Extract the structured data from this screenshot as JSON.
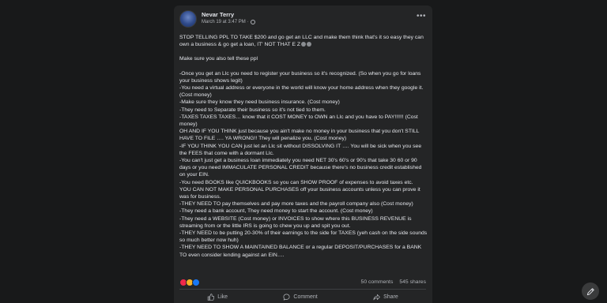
{
  "post": {
    "author": "Nevar Terry",
    "timestamp": "March 19 at 3:47 PM",
    "separator": "·",
    "lines": [
      "STOP TELLING PPL TO TAKE $200 and go get an LLC and make them think that's it so easy they can own a business & go get a loan, IT' NOT THAT E Z",
      "",
      "Make sure you also tell these ppl",
      "",
      "-Once you get an Llc you need to register your business so it's recognized. (So when you go for loans your business shows legit)",
      "-You need a virtual address or everyone in the world will know your home address when they google it. (Cost money)",
      "-Make sure they know they need business insurance. (Cost money)",
      "-They need to Separate their business so it's not tied to them.",
      "-TAXES TAXES TAXES… know that it COST MONEY to OWN an Llc and you have to PAY!!!!!! (Cost money)",
      "OH AND IF YOU THINK just because you ain't make no money in your business that you don't STILL HAVE TO FILE …. YA WRONG!! They will penalize you. (Cost money)",
      "-IF YOU THINK YOU CAN just let an Llc sit without DISSOLVING IT …. You will be sick when you see the FEES that come with a dormant Llc.",
      "-You can't just get a business loan immediately you need NET 30's 60's or 90's that take 30 60 or 90 days or you need IMMACULATE PERSONAL CREDIT because there's no business credit established on your EIN.",
      "-You need BOOKS like QUICKBOOKS so you can SHOW PROOF of expenses to avoid taxes etc.",
      "YOU CAN NOT MAKE PERSONAL PURCHASES off your business accounts unless you can prove it was for business.",
      "-THEY NEED TO pay themselves and pay more taxes and the payroll company also (Cost money)",
      "-They need a bank account, They need money to start the account. (Cost money)",
      "-They need a WEBSITE (Cost money) or INVOICES to show where this BUSINESS REVENUE is streaming from or the little IRS is going to chew you up and spit you out.",
      "-THEY NEED to be putting 20-30% of their earnings to the side for TAXES (yeh cash on the side sounds so much better now huh)",
      "-THEY NEED TO SHOW A MAINTAINED BALANCE or a regular DEPOSIT/PURCHASES for a BANK TO even consider lending against an EIN…."
    ]
  },
  "stats": {
    "comments": "50 comments",
    "shares": "545 shares"
  },
  "actions": {
    "like": "Like",
    "comment": "Comment",
    "share": "Share"
  }
}
